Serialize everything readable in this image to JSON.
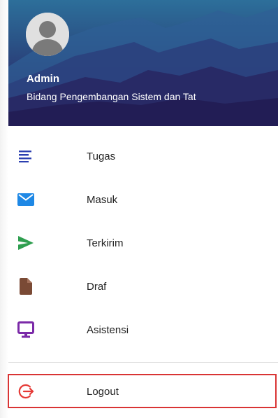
{
  "profile": {
    "name": "Admin",
    "department": "Bidang Pengembangan Sistem dan Tat"
  },
  "menu": {
    "items": [
      {
        "label": "Tugas",
        "icon": "list-icon",
        "color": "#2b3fb0"
      },
      {
        "label": "Masuk",
        "icon": "mail-icon",
        "color": "#1e88e5"
      },
      {
        "label": "Terkirim",
        "icon": "send-icon",
        "color": "#2e9e4f"
      },
      {
        "label": "Draf",
        "icon": "document-icon",
        "color": "#7a4a35"
      },
      {
        "label": "Asistensi",
        "icon": "monitor-icon",
        "color": "#7b2aa8"
      }
    ]
  },
  "logout": {
    "label": "Logout",
    "icon": "logout-icon",
    "color": "#e53935",
    "highlight_border": "#d93434"
  }
}
